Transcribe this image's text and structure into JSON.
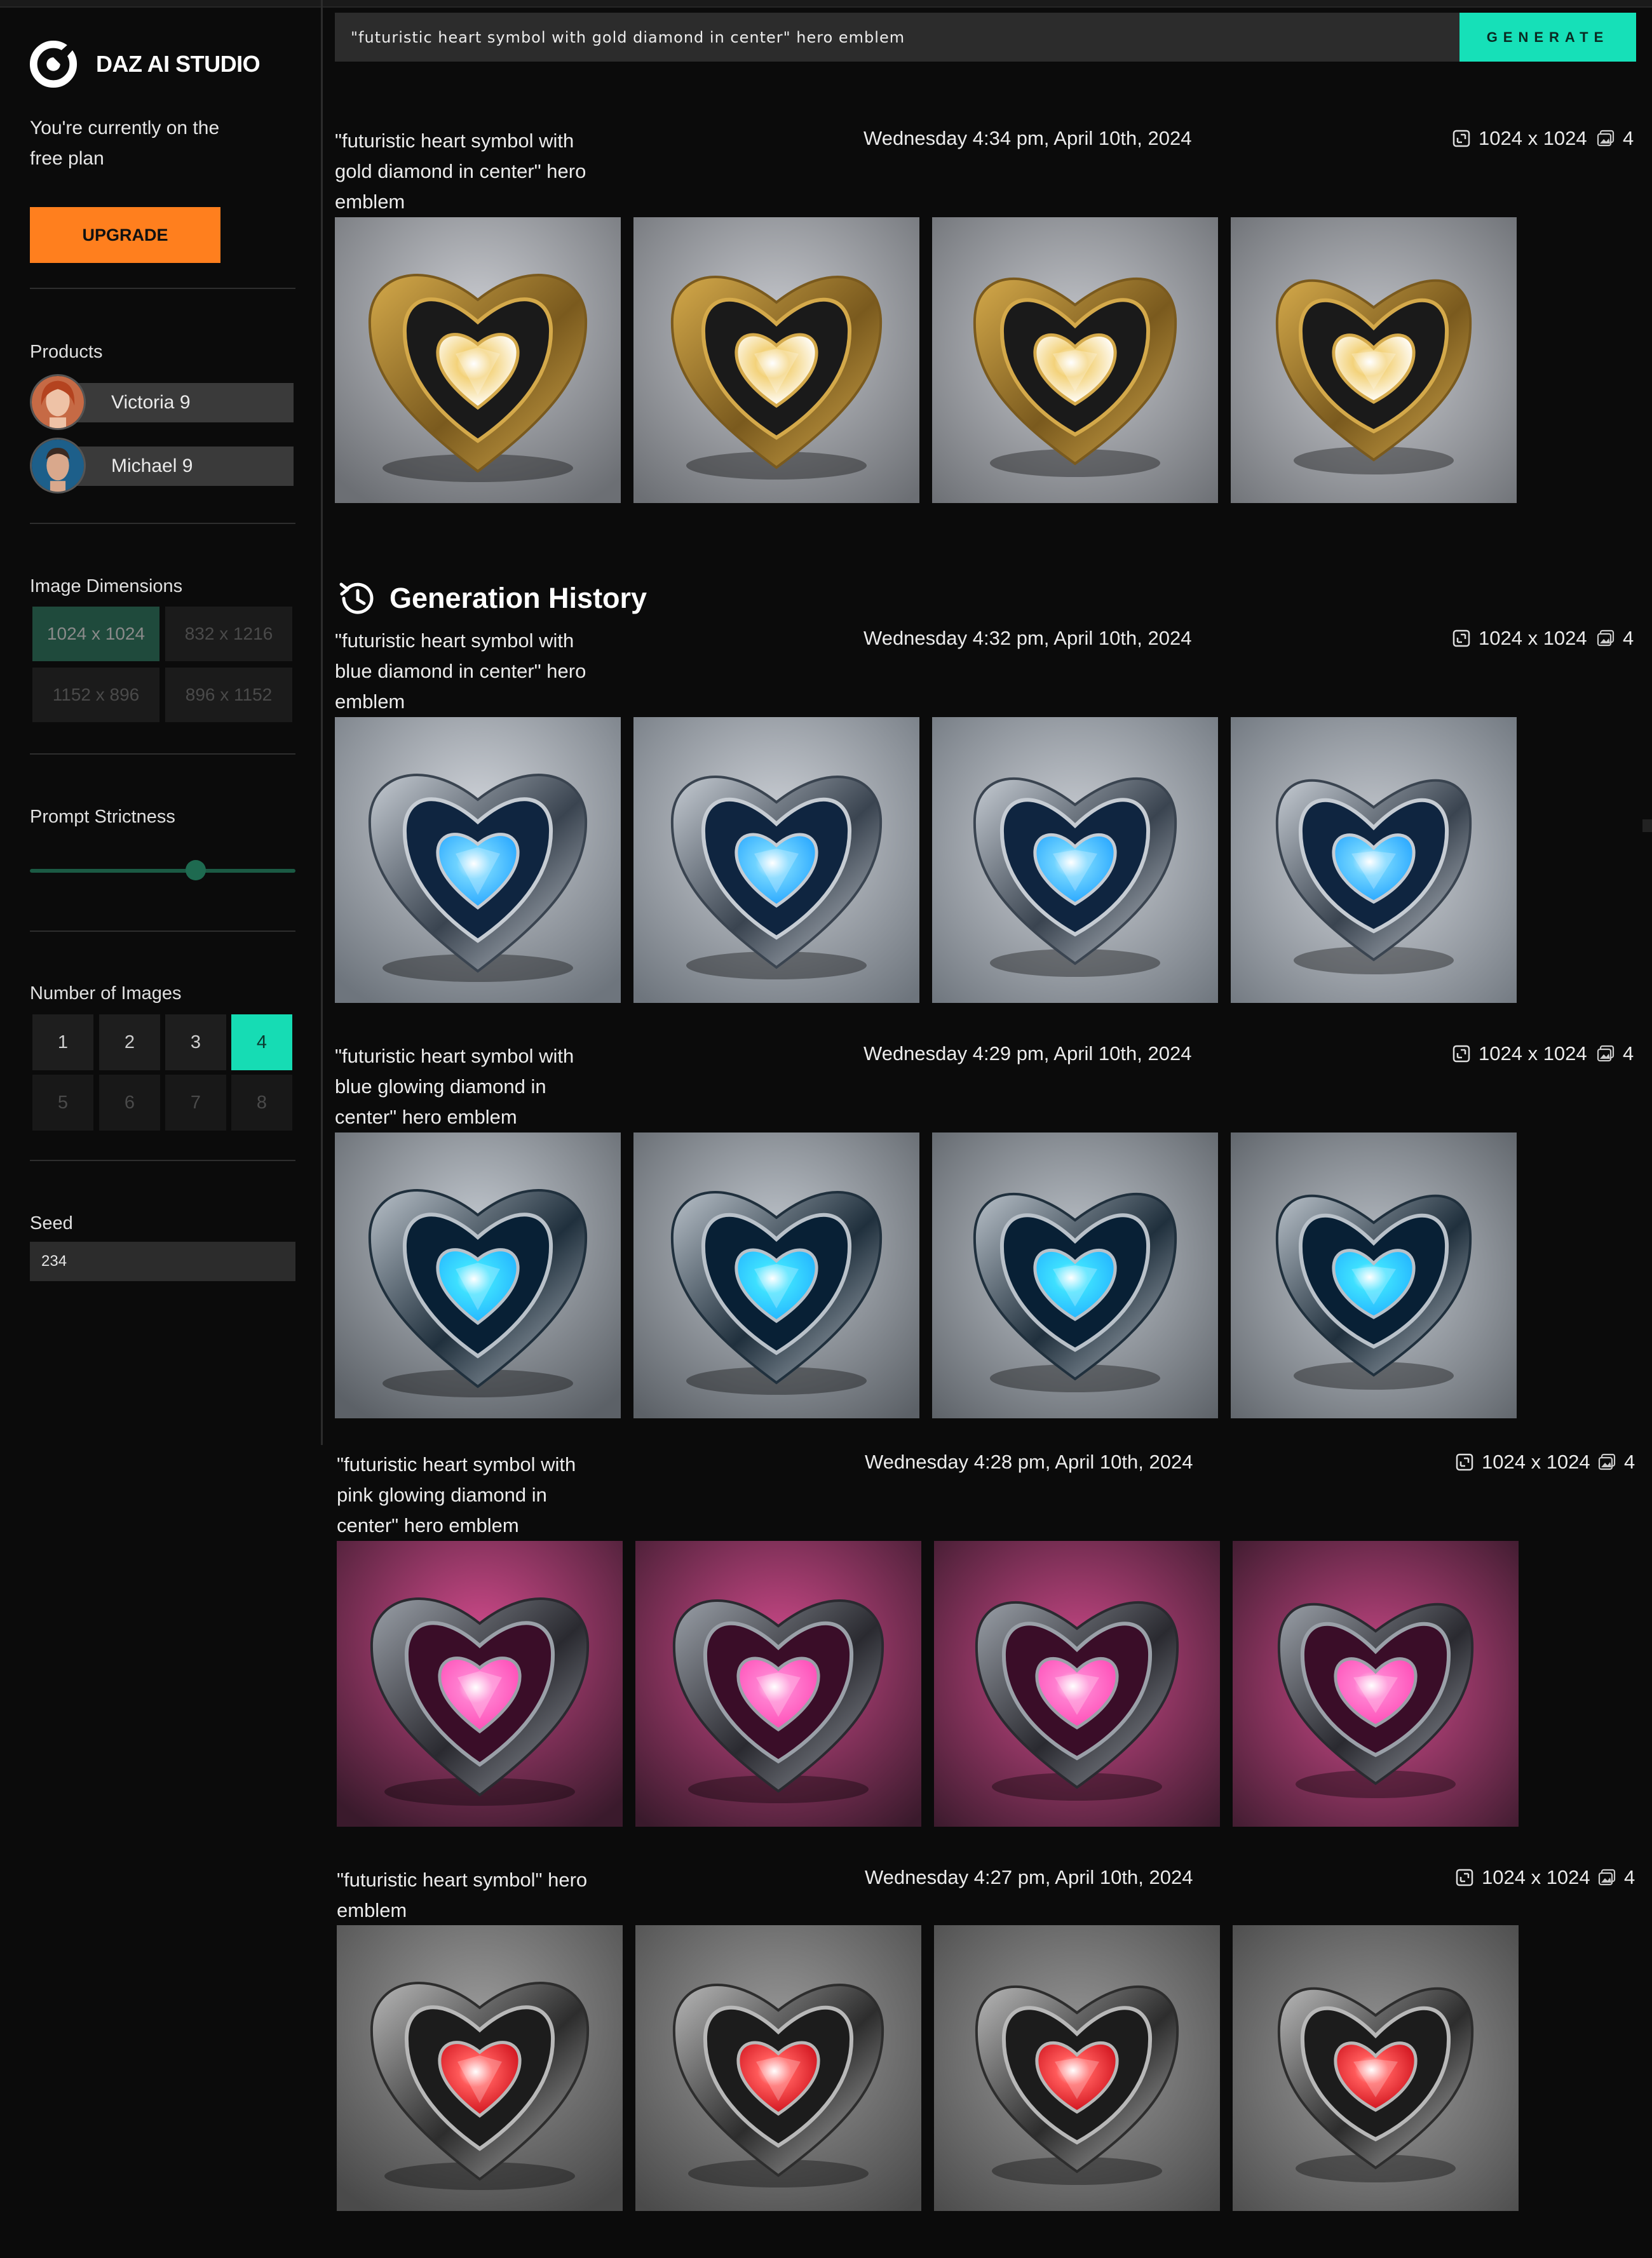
{
  "app": {
    "name": "DAZ AI STUDIO"
  },
  "plan": {
    "text": "You're currently on the free plan",
    "upgrade_label": "UPGRADE"
  },
  "products": {
    "label": "Products",
    "items": [
      {
        "name": "Victoria 9"
      },
      {
        "name": "Michael 9"
      }
    ]
  },
  "dimensions": {
    "label": "Image Dimensions",
    "options": [
      "1024 x 1024",
      "832 x 1216",
      "1152 x 896",
      "896 x 1152"
    ],
    "selected": "1024 x 1024"
  },
  "strictness": {
    "label": "Prompt Strictness",
    "value": 0.62
  },
  "num_images": {
    "label": "Number of Images",
    "options": [
      "1",
      "2",
      "3",
      "4",
      "5",
      "6",
      "7",
      "8"
    ],
    "selected": "4"
  },
  "seed": {
    "label": "Seed",
    "value": "234"
  },
  "prompt": {
    "value": "\"futuristic heart symbol with gold diamond in center\" hero emblem",
    "generate_label": "GENERATE"
  },
  "history_title": "Generation History",
  "colors": {
    "accent": "#16e0b8",
    "upgrade": "#ff7f1e",
    "background": "#0b0b0b"
  },
  "generations": [
    {
      "prompt": "\"futuristic heart symbol with gold diamond in center\" hero emblem",
      "date": "Wednesday 4:34 pm, April 10th, 2024",
      "resolution": "1024 x 1024",
      "count": "4",
      "theme": "gold"
    },
    {
      "prompt": "\"futuristic heart symbol with blue diamond in center\" hero emblem",
      "date": "Wednesday 4:32 pm, April 10th, 2024",
      "resolution": "1024 x 1024",
      "count": "4",
      "theme": "blue"
    },
    {
      "prompt": "\"futuristic heart symbol with blue glowing diamond in center\" hero emblem",
      "date": "Wednesday 4:29 pm, April 10th, 2024",
      "resolution": "1024 x 1024",
      "count": "4",
      "theme": "glow"
    },
    {
      "prompt": "\"futuristic heart symbol with pink glowing diamond in center\" hero emblem",
      "date": "Wednesday 4:28 pm, April 10th, 2024",
      "resolution": "1024 x 1024",
      "count": "4",
      "theme": "pink"
    },
    {
      "prompt": "\"futuristic heart symbol\" hero emblem",
      "date": "Wednesday 4:27 pm, April 10th, 2024",
      "resolution": "1024 x 1024",
      "count": "4",
      "theme": "red"
    }
  ]
}
